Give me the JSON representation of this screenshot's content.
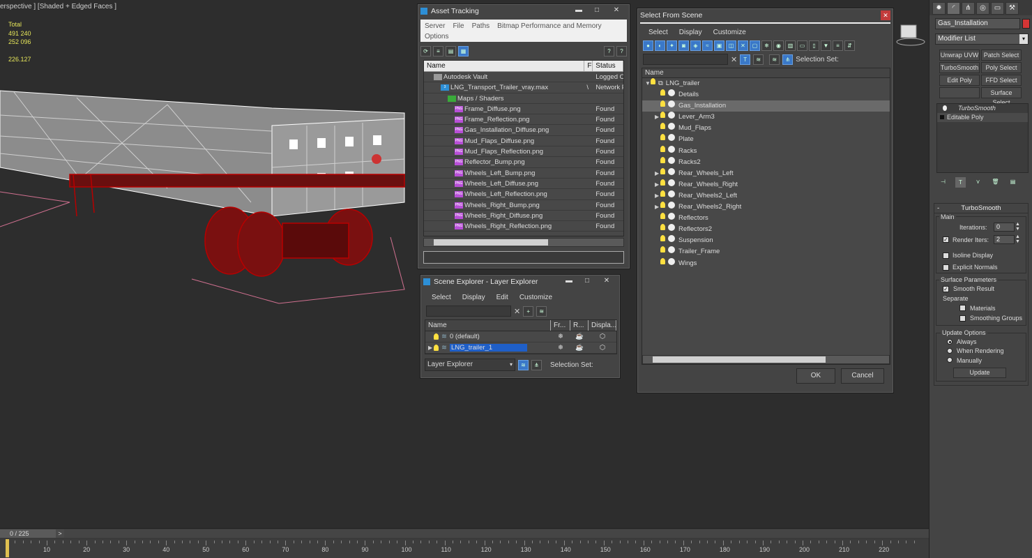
{
  "viewport": {
    "label": "erspective ] [Shaded + Edged Faces ]",
    "stats": [
      "Total",
      "491 240",
      "252 096",
      "",
      "226.127"
    ]
  },
  "asset_tracking": {
    "title": "Asset Tracking",
    "menu": [
      "Server",
      "File",
      "Paths",
      "Bitmap Performance and Memory",
      "Options"
    ],
    "columns": [
      "Name",
      "F",
      "Status"
    ],
    "rows": [
      {
        "name": "Autodesk Vault",
        "f": "",
        "status": "Logged O",
        "indent": 1,
        "icon": "vault"
      },
      {
        "name": "LNG_Transport_Trailer_vray.max",
        "f": "\\",
        "status": "Network P",
        "indent": 2,
        "icon": "max"
      },
      {
        "name": "Maps / Shaders",
        "f": "",
        "status": "",
        "indent": 3,
        "icon": "maps"
      },
      {
        "name": "Frame_Diffuse.png",
        "f": "",
        "status": "Found",
        "indent": 4,
        "icon": "png"
      },
      {
        "name": "Frame_Reflection.png",
        "f": "",
        "status": "Found",
        "indent": 4,
        "icon": "png"
      },
      {
        "name": "Gas_Installation_Diffuse.png",
        "f": "",
        "status": "Found",
        "indent": 4,
        "icon": "png"
      },
      {
        "name": "Mud_Flaps_Diffuse.png",
        "f": "",
        "status": "Found",
        "indent": 4,
        "icon": "png"
      },
      {
        "name": "Mud_Flaps_Reflection.png",
        "f": "",
        "status": "Found",
        "indent": 4,
        "icon": "png"
      },
      {
        "name": "Reflector_Bump.png",
        "f": "",
        "status": "Found",
        "indent": 4,
        "icon": "png"
      },
      {
        "name": "Wheels_Left_Bump.png",
        "f": "",
        "status": "Found",
        "indent": 4,
        "icon": "png"
      },
      {
        "name": "Wheels_Left_Diffuse.png",
        "f": "",
        "status": "Found",
        "indent": 4,
        "icon": "png"
      },
      {
        "name": "Wheels_Left_Reflection.png",
        "f": "",
        "status": "Found",
        "indent": 4,
        "icon": "png"
      },
      {
        "name": "Wheels_Right_Bump.png",
        "f": "",
        "status": "Found",
        "indent": 4,
        "icon": "png"
      },
      {
        "name": "Wheels_Right_Diffuse.png",
        "f": "",
        "status": "Found",
        "indent": 4,
        "icon": "png"
      },
      {
        "name": "Wheels_Right_Reflection.png",
        "f": "",
        "status": "Found",
        "indent": 4,
        "icon": "png"
      }
    ]
  },
  "layer_explorer": {
    "title": "Scene Explorer - Layer Explorer",
    "menu": [
      "Select",
      "Display",
      "Edit",
      "Customize"
    ],
    "columns": [
      "Name",
      "Fr...",
      "R...",
      "Displa..."
    ],
    "rows": [
      {
        "name": "0 (default)",
        "expand": false,
        "selected": false
      },
      {
        "name": "LNG_trailer_1",
        "expand": true,
        "selected": true
      }
    ],
    "dropdown": "Layer Explorer",
    "selection_set": "Selection Set:"
  },
  "select_scene": {
    "title": "Select From Scene",
    "menu": [
      "Select",
      "Display",
      "Customize"
    ],
    "selection_set": "Selection Set:",
    "column": "Name",
    "root": "LNG_trailer",
    "items": [
      {
        "name": "Details",
        "expand": false
      },
      {
        "name": "Gas_Installation",
        "expand": false,
        "selected": true
      },
      {
        "name": "Lever_Arm3",
        "expand": true
      },
      {
        "name": "Mud_Flaps",
        "expand": false
      },
      {
        "name": "Plate",
        "expand": false
      },
      {
        "name": "Racks",
        "expand": false
      },
      {
        "name": "Racks2",
        "expand": false
      },
      {
        "name": "Rear_Wheels_Left",
        "expand": true
      },
      {
        "name": "Rear_Wheels_Right",
        "expand": true
      },
      {
        "name": "Rear_Wheels2_Left",
        "expand": true
      },
      {
        "name": "Rear_Wheels2_Right",
        "expand": true
      },
      {
        "name": "Reflectors",
        "expand": false
      },
      {
        "name": "Reflectors2",
        "expand": false
      },
      {
        "name": "Suspension",
        "expand": false
      },
      {
        "name": "Trailer_Frame",
        "expand": false
      },
      {
        "name": "Wings",
        "expand": false
      }
    ],
    "ok": "OK",
    "cancel": "Cancel"
  },
  "command_panel": {
    "object_name": "Gas_Installation",
    "modifier_list": "Modifier List",
    "buttons": [
      "Unwrap UVW",
      "Patch Select",
      "TurboSmooth",
      "Poly Select",
      "Edit Poly",
      "FFD Select",
      "",
      "Surface Select"
    ],
    "stack": [
      "TurboSmooth",
      "Editable Poly"
    ],
    "rollout_title": "TurboSmooth",
    "main": "Main",
    "iterations_label": "Iterations:",
    "iterations": "0",
    "render_iters_label": "Render Iters:",
    "render_iters": "2",
    "isoline": "Isoline Display",
    "explicit": "Explicit Normals",
    "surface_params": "Surface Parameters",
    "smooth_result": "Smooth Result",
    "separate": "Separate",
    "materials": "Materials",
    "smoothing_groups": "Smoothing Groups",
    "update_options": "Update Options",
    "always": "Always",
    "when_rendering": "When Rendering",
    "manually": "Manually",
    "update": "Update"
  },
  "timeline": {
    "frame": "0 / 225",
    "arrow": ">",
    "ticks": [
      "10",
      "20",
      "30",
      "40",
      "50",
      "60",
      "70",
      "80",
      "90",
      "100",
      "110",
      "120",
      "130",
      "140",
      "150",
      "160",
      "170",
      "180",
      "190",
      "200",
      "210",
      "220"
    ]
  }
}
